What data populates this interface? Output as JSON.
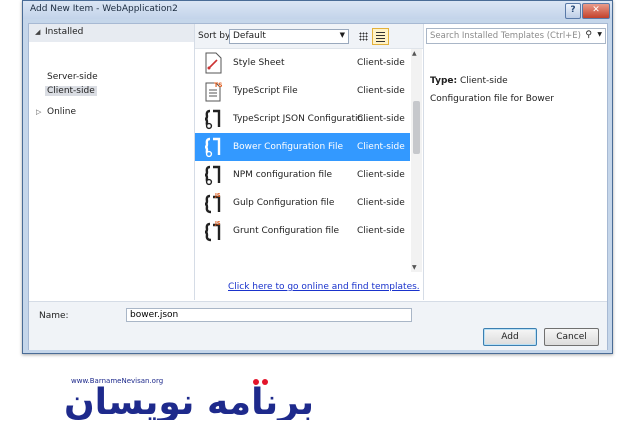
{
  "window": {
    "title": "Add New Item - WebApplication2",
    "help_button": "?",
    "close_button": "✕"
  },
  "left_panel": {
    "installed_label": "Installed",
    "items": [
      "Server-side",
      "Client-side"
    ],
    "online_label": "Online"
  },
  "center_panel": {
    "sort_label": "Sort by:",
    "sort_value": "Default",
    "templates": [
      {
        "name": "Style Sheet",
        "category": "Client-side",
        "icon": "css-file-icon"
      },
      {
        "name": "TypeScript File",
        "category": "Client-side",
        "icon": "typescript-file-icon"
      },
      {
        "name": "TypeScript JSON Configuratio...",
        "category": "Client-side",
        "icon": "json-config-icon"
      },
      {
        "name": "Bower Configuration File",
        "category": "Client-side",
        "icon": "json-config-icon"
      },
      {
        "name": "NPM configuration file",
        "category": "Client-side",
        "icon": "json-config-icon"
      },
      {
        "name": "Gulp Configuration file",
        "category": "Client-side",
        "icon": "js-config-icon"
      },
      {
        "name": "Grunt Configuration file",
        "category": "Client-side",
        "icon": "js-config-icon"
      }
    ],
    "selected_index": 3,
    "online_link": "Click here to go online and find templates."
  },
  "right_panel": {
    "search_placeholder": "Search Installed Templates (Ctrl+E)",
    "type_label": "Type:",
    "type_value": "Client-side",
    "description": "Configuration file for Bower"
  },
  "bottom": {
    "name_label": "Name:",
    "name_value": "bower.json",
    "add_label": "Add",
    "cancel_label": "Cancel"
  },
  "logo": {
    "url_text": "www.BarnameNevisan.org",
    "main_text": "برنامه نویسان"
  },
  "colors": {
    "selection": "#3399ff",
    "window_frame": "#c5d6ea",
    "logo_blue": "#1e2a8c",
    "logo_red": "#e3142b"
  }
}
